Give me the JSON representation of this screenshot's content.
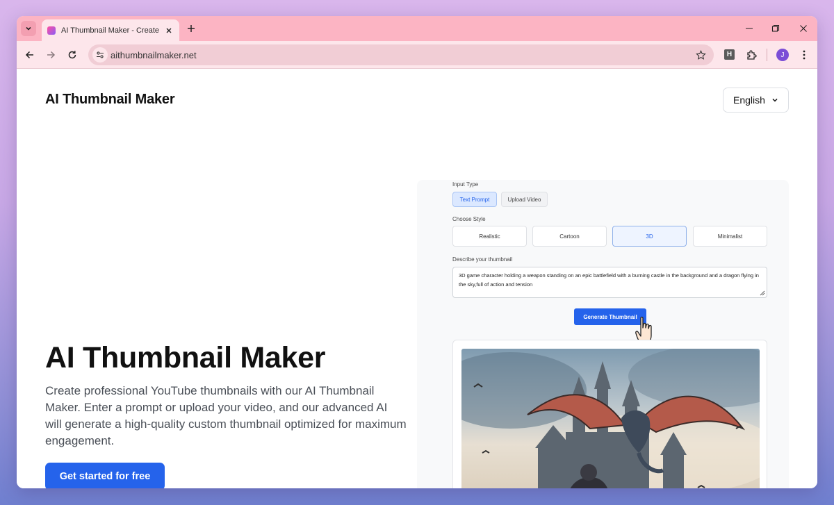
{
  "browser": {
    "tab_title": "AI Thumbnail Maker - Create Cu",
    "url": "aithumbnailmaker.net",
    "extension_label": "H",
    "profile_initial": "J"
  },
  "header": {
    "brand": "AI Thumbnail Maker",
    "language": "English"
  },
  "hero": {
    "title": "AI Thumbnail Maker",
    "description": "Create professional YouTube thumbnails with our AI Thumbnail Maker. Enter a prompt or upload your video, and our advanced AI will generate a high-quality custom thumbnail optimized for maximum engagement.",
    "cta": "Get started for free"
  },
  "demo": {
    "input_type_label": "Input Type",
    "input_types": [
      "Text Prompt",
      "Upload Video"
    ],
    "selected_input_type": "Text Prompt",
    "choose_style_label": "Choose Style",
    "styles": [
      "Realistic",
      "Cartoon",
      "3D",
      "Minimalist"
    ],
    "selected_style": "3D",
    "describe_label": "Describe your thumbnail",
    "prompt_text": "3D game character holding a weapon standing on an epic battlefield with a burning castle in the background and a dragon flying in the sky,full of action and tension",
    "generate_button": "Generate Thumbnail"
  },
  "colors": {
    "tabstrip": "#fcb4c3",
    "toolbar": "#fde6eb",
    "accent": "#2563eb"
  }
}
